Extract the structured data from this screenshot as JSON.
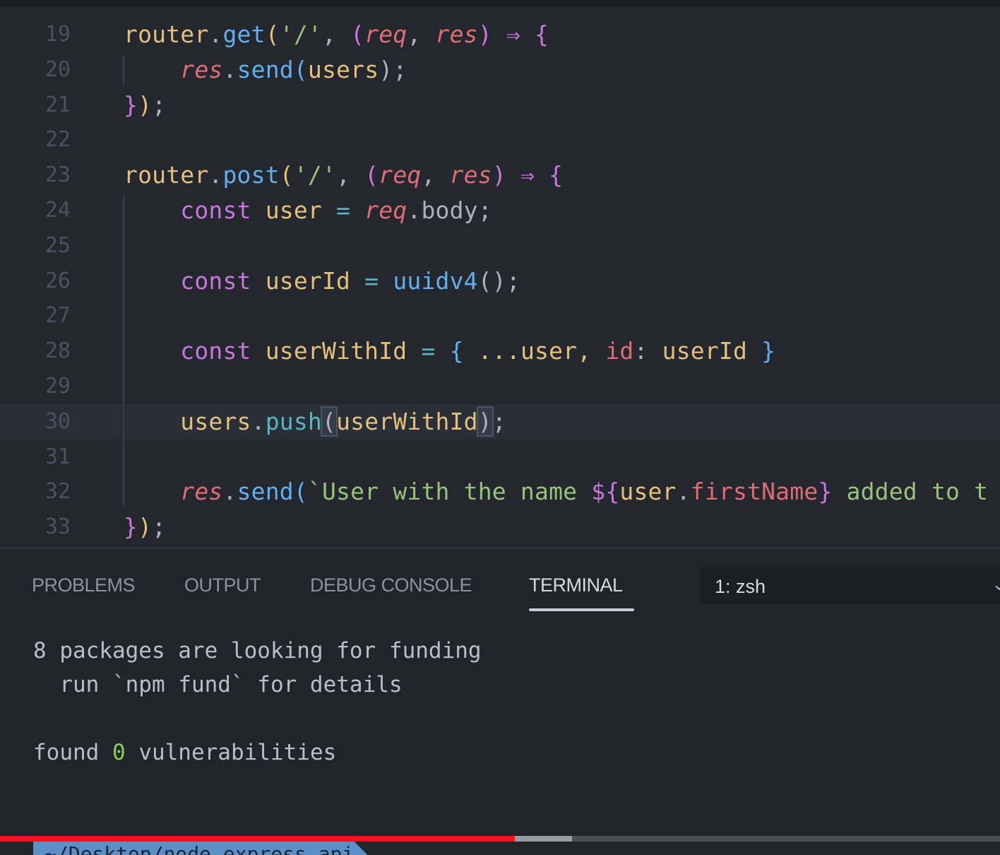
{
  "editor": {
    "current_line": 30,
    "lines": [
      {
        "num": "19",
        "tokens": [
          [
            "router",
            "y"
          ],
          [
            ".",
            "w"
          ],
          [
            "get",
            "f"
          ],
          [
            "(",
            "y"
          ],
          [
            "'/'",
            "s"
          ],
          [
            ", ",
            "w"
          ],
          [
            "(",
            "k"
          ],
          [
            "req",
            "p"
          ],
          [
            ", ",
            "w"
          ],
          [
            "res",
            "p"
          ],
          [
            ")",
            "k"
          ],
          [
            " ⇒ ",
            "m"
          ],
          [
            "{",
            "k"
          ]
        ]
      },
      {
        "num": "20",
        "tokens": [
          [
            "    ",
            "w"
          ],
          [
            "res",
            "p"
          ],
          [
            ".",
            "w"
          ],
          [
            "send",
            "f"
          ],
          [
            "(",
            "f"
          ],
          [
            "users",
            "y"
          ],
          [
            ");",
            "w"
          ]
        ]
      },
      {
        "num": "21",
        "tokens": [
          [
            "}",
            "k"
          ],
          [
            ")",
            "y"
          ],
          [
            ";",
            "w"
          ]
        ]
      },
      {
        "num": "22",
        "tokens": []
      },
      {
        "num": "23",
        "tokens": [
          [
            "router",
            "y"
          ],
          [
            ".",
            "w"
          ],
          [
            "post",
            "f"
          ],
          [
            "(",
            "y"
          ],
          [
            "'/'",
            "s"
          ],
          [
            ", ",
            "w"
          ],
          [
            "(",
            "k"
          ],
          [
            "req",
            "p"
          ],
          [
            ", ",
            "w"
          ],
          [
            "res",
            "p"
          ],
          [
            ")",
            "k"
          ],
          [
            " ⇒ ",
            "m"
          ],
          [
            "{",
            "k"
          ]
        ]
      },
      {
        "num": "24",
        "tokens": [
          [
            "    ",
            "w"
          ],
          [
            "const",
            "k"
          ],
          [
            " user ",
            "y"
          ],
          [
            "=",
            "cy"
          ],
          [
            " ",
            "w"
          ],
          [
            "req",
            "p"
          ],
          [
            ".body;",
            "w"
          ]
        ]
      },
      {
        "num": "25",
        "tokens": []
      },
      {
        "num": "26",
        "tokens": [
          [
            "    ",
            "w"
          ],
          [
            "const",
            "k"
          ],
          [
            " userId ",
            "y"
          ],
          [
            "=",
            "cy"
          ],
          [
            " ",
            "w"
          ],
          [
            "uuidv4",
            "f"
          ],
          [
            "();",
            "w"
          ]
        ]
      },
      {
        "num": "27",
        "tokens": []
      },
      {
        "num": "28",
        "tokens": [
          [
            "    ",
            "w"
          ],
          [
            "const",
            "k"
          ],
          [
            " userWithId ",
            "y"
          ],
          [
            "=",
            "cy"
          ],
          [
            " ",
            "w"
          ],
          [
            "{",
            "f"
          ],
          [
            " ...user, ",
            "y"
          ],
          [
            "id",
            "pr"
          ],
          [
            ": ",
            "w"
          ],
          [
            "userId ",
            "y"
          ],
          [
            "}",
            "f"
          ]
        ]
      },
      {
        "num": "29",
        "tokens": []
      },
      {
        "num": "30",
        "tokens": [
          [
            "    ",
            "w"
          ],
          [
            "users",
            "y"
          ],
          [
            ".",
            "w"
          ],
          [
            "push",
            "cy"
          ],
          [
            "(",
            "bmw"
          ],
          [
            "userWithId",
            "y"
          ],
          [
            ")",
            "bmw"
          ],
          [
            ";",
            "w"
          ]
        ]
      },
      {
        "num": "31",
        "tokens": []
      },
      {
        "num": "32",
        "tokens": [
          [
            "    ",
            "w"
          ],
          [
            "res",
            "p"
          ],
          [
            ".",
            "w"
          ],
          [
            "send",
            "f"
          ],
          [
            "(",
            "f"
          ],
          [
            "`User with the name ",
            "s"
          ],
          [
            "${",
            "m"
          ],
          [
            "user",
            "y"
          ],
          [
            ".",
            "w"
          ],
          [
            "firstName",
            "pr"
          ],
          [
            "}",
            "m"
          ],
          [
            " added to t",
            "s"
          ]
        ]
      },
      {
        "num": "33",
        "tokens": [
          [
            "}",
            "k"
          ],
          [
            ")",
            "y"
          ],
          [
            ";",
            "w"
          ]
        ]
      }
    ]
  },
  "panel": {
    "tabs": [
      {
        "label": "PROBLEMS",
        "active": false
      },
      {
        "label": "OUTPUT",
        "active": false
      },
      {
        "label": "DEBUG CONSOLE",
        "active": false
      },
      {
        "label": "TERMINAL",
        "active": true
      }
    ],
    "terminal_select": "1: zsh",
    "terminal_lines": {
      "l1": "8 packages are looking for funding",
      "l2": "  run `npm fund` for details",
      "l3_a": "found ",
      "l3_num": "0",
      "l3_b": " vulnerabilities"
    },
    "prompt_path": "~/Desktop/node_express_api"
  },
  "video": {
    "played_fraction": 0.515,
    "buffered_fraction": 0.572,
    "played_color": "#ff1020"
  }
}
